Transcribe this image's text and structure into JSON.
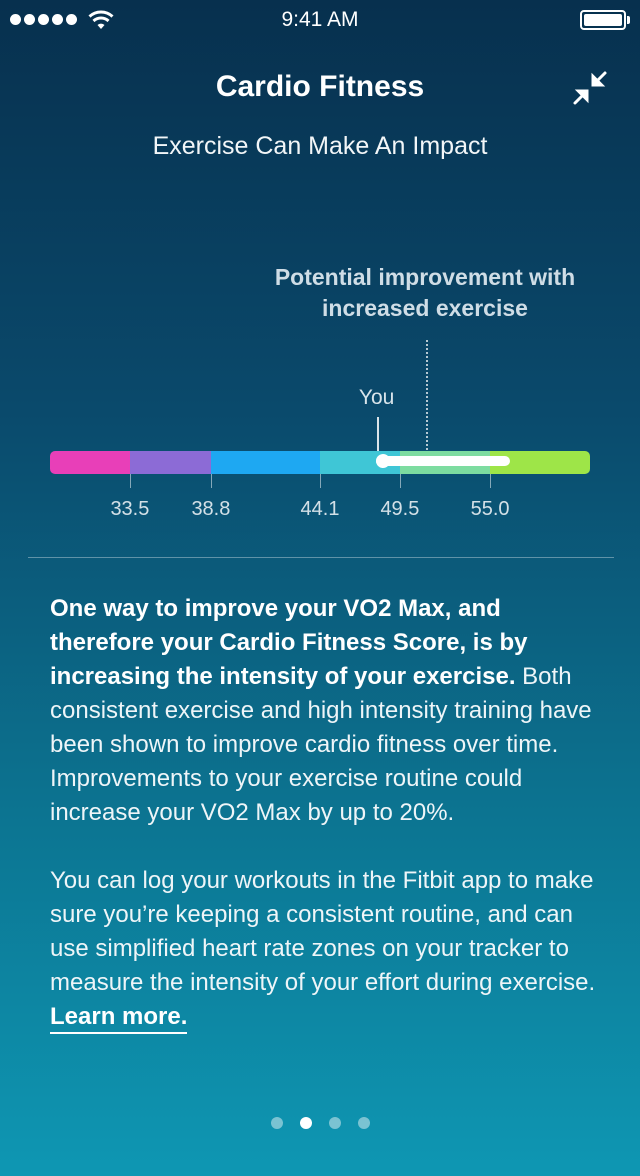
{
  "status_bar": {
    "time": "9:41 AM",
    "signal_bars": 5,
    "battery_level": 1.0
  },
  "header": {
    "title": "Cardio Fitness",
    "collapse_icon": "collapse-arrows-icon",
    "subtitle": "Exercise Can Make An Impact"
  },
  "scale": {
    "potential_label": "Potential improvement with increased exercise",
    "you_label": "You",
    "segments": [
      {
        "color": "#e83fb8",
        "from": 0,
        "to": 0.148
      },
      {
        "color": "#8c6bd6",
        "from": 0.148,
        "to": 0.298
      },
      {
        "color": "#1ea8f2",
        "from": 0.298,
        "to": 0.5
      },
      {
        "color": "#3fc6d6",
        "from": 0.5,
        "to": 0.648
      },
      {
        "color": "#7ddca0",
        "from": 0.648,
        "to": 0.815
      },
      {
        "color": "#9ee548",
        "from": 0.815,
        "to": 1.0
      }
    ],
    "ticks": [
      "33.5",
      "38.8",
      "44.1",
      "49.5",
      "55.0"
    ],
    "tick_positions": [
      0.148,
      0.298,
      0.5,
      0.648,
      0.815
    ],
    "you_position": 0.603,
    "potential_position": 0.696
  },
  "content": {
    "bold_intro": "One way to improve your VO2 Max, and therefore your Cardio Fitness Score, is by increasing the intensity of your exercise.",
    "para1_rest": " Both consistent exercise and high intensity training have been shown to improve cardio fitness over time. Improvements to your exercise routine could increase your VO2 Max by up to 20%.",
    "para2": "You can log your workouts in the Fitbit app to make sure you’re keeping a consistent routine, and can use simplified heart rate zones on your tracker to measure the intensity of your effort during exercise.",
    "learn_more": "Learn more."
  },
  "pager": {
    "count": 4,
    "active_index": 1
  }
}
